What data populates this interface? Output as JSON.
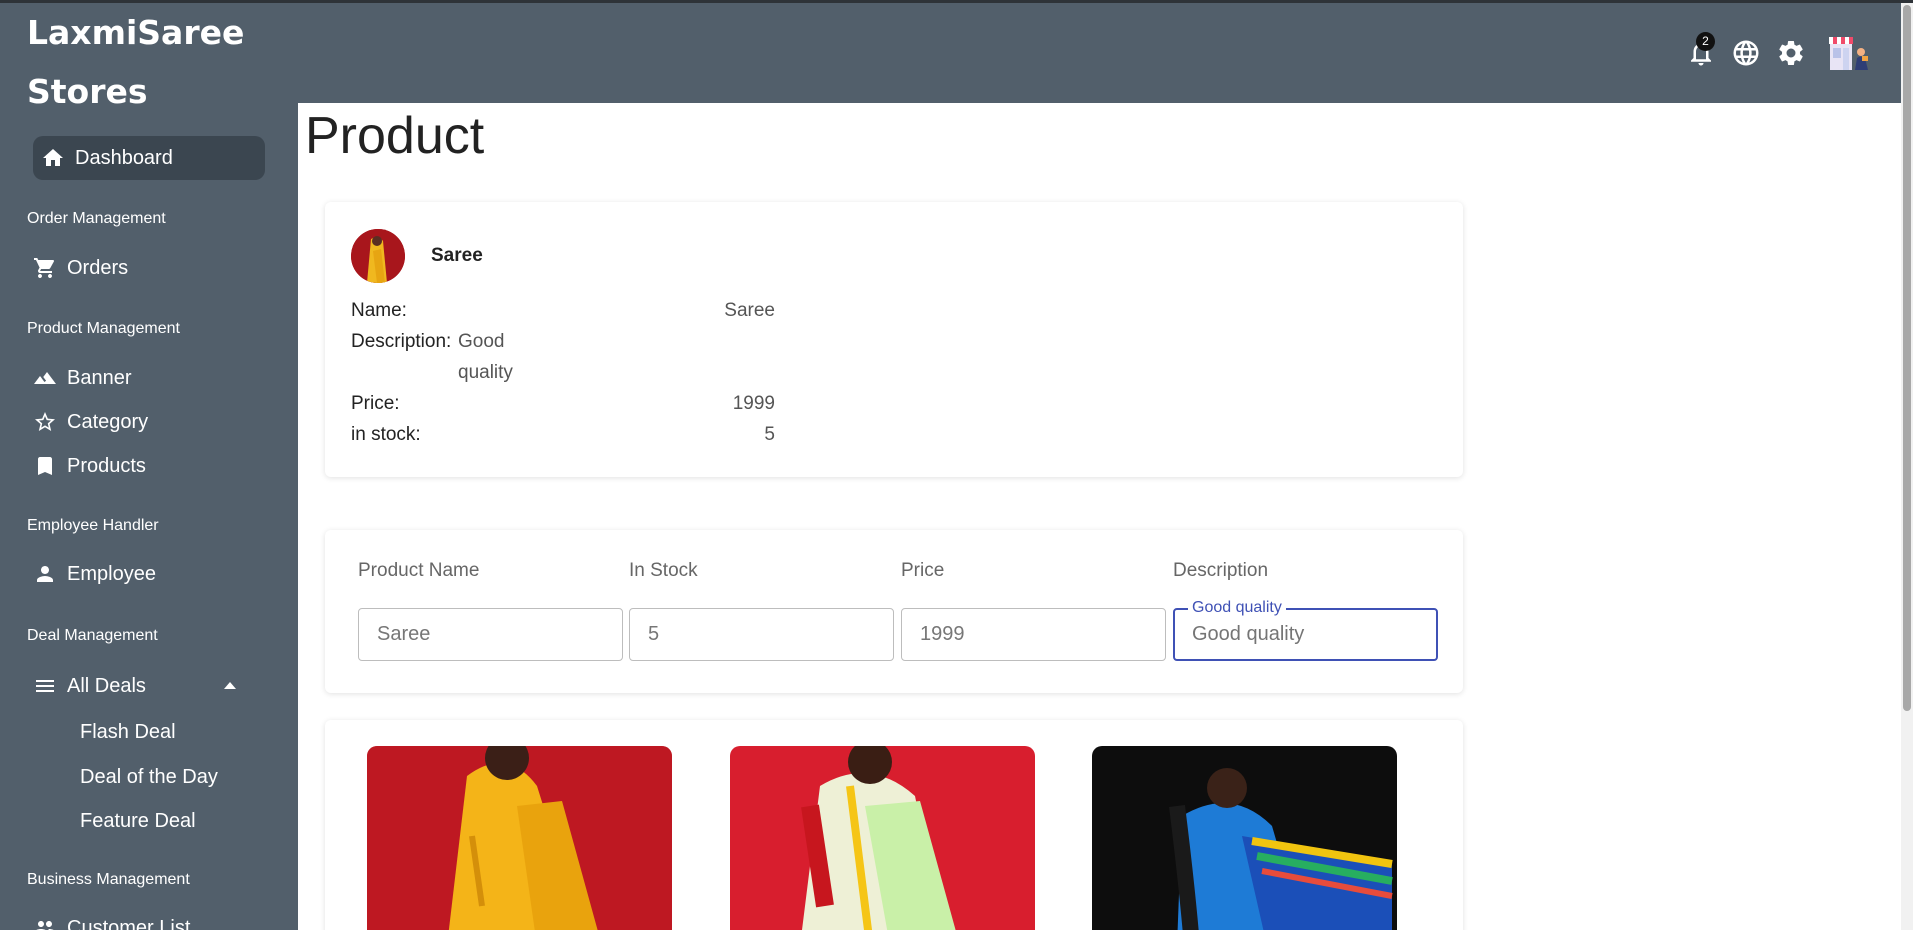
{
  "brand": {
    "line1": "LaxmiSaree",
    "line2": "Stores"
  },
  "sidebar": {
    "dashboard": "Dashboard",
    "sections": {
      "order": "Order Management",
      "product": "Product Management",
      "employee": "Employee Handler",
      "deal": "Deal Management",
      "business": "Business Management"
    },
    "orders": "Orders",
    "banner": "Banner",
    "category": "Category",
    "products": "Products",
    "employee": "Employee",
    "all_deals": "All Deals",
    "flash_deal": "Flash Deal",
    "deal_of_day": "Deal of the Day",
    "feature_deal": "Feature Deal",
    "customer_list": "Customer List"
  },
  "header": {
    "notification_count": "2"
  },
  "page": {
    "title": "Product"
  },
  "product": {
    "heading": "Saree",
    "name_label": "Name:",
    "name_value": "Saree",
    "desc_label": "Description:",
    "desc_value_line1": "Good",
    "desc_value_line2": "quality",
    "price_label": "Price:",
    "price_value": "1999",
    "stock_label": "in stock:",
    "stock_value": "5"
  },
  "form": {
    "product_name_label": "Product Name",
    "in_stock_label": "In Stock",
    "price_label": "Price",
    "description_label": "Description",
    "product_name_value": "Saree",
    "in_stock_value": "5",
    "price_value": "1999",
    "description_placeholder": "Good quality",
    "description_float_label": "Good quality"
  },
  "colors": {
    "sidebar": "#525f6b",
    "accent": "#3f51b5"
  }
}
